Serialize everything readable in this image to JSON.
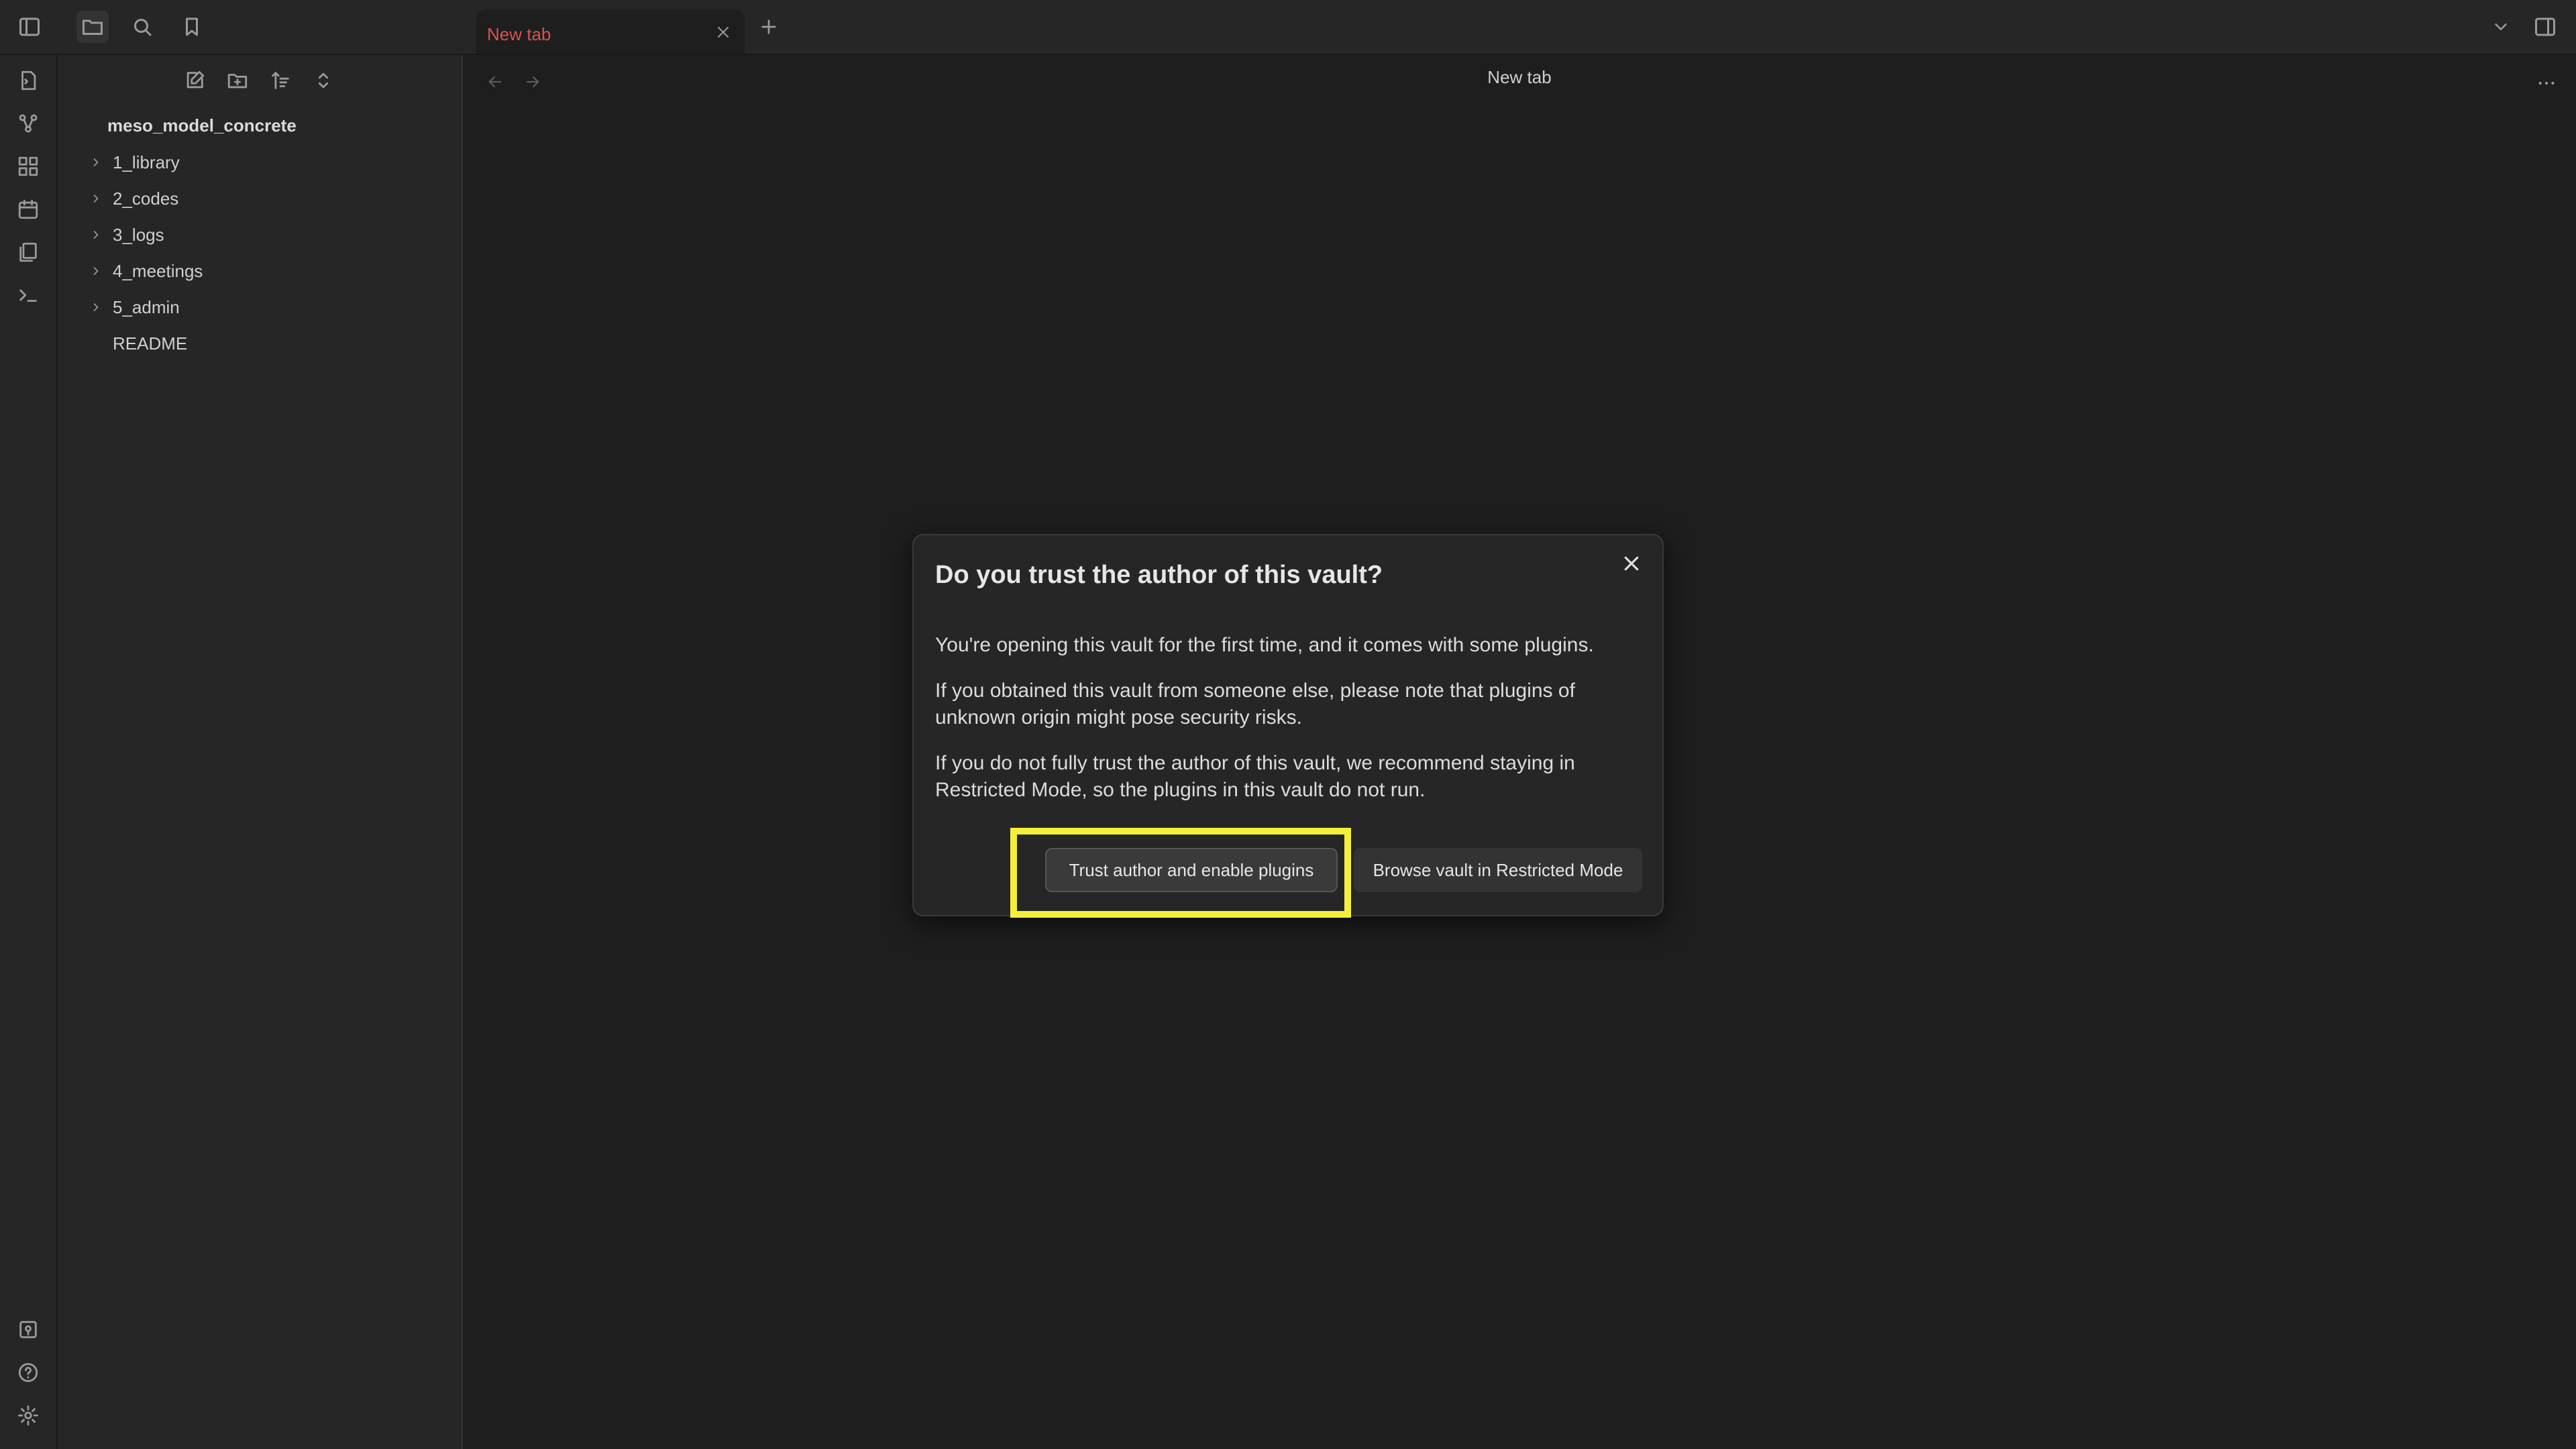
{
  "tabs": [
    {
      "label": "New tab",
      "active": true
    }
  ],
  "sidebar": {
    "vault_name": "meso_model_concrete",
    "items": [
      {
        "label": "1_library",
        "type": "folder"
      },
      {
        "label": "2_codes",
        "type": "folder"
      },
      {
        "label": "3_logs",
        "type": "folder"
      },
      {
        "label": "4_meetings",
        "type": "folder"
      },
      {
        "label": "5_admin",
        "type": "folder"
      },
      {
        "label": "README",
        "type": "file"
      }
    ]
  },
  "main": {
    "view_title": "New tab"
  },
  "modal": {
    "title": "Do you trust the author of this vault?",
    "paragraphs": [
      "You're opening this vault for the first time, and it comes with some plugins.",
      "If you obtained this vault from someone else, please note that plugins of unknown origin might pose security risks.",
      "If you do not fully trust the author of this vault, we recommend staying in Restricted Mode, so the plugins in this vault do not run."
    ],
    "trust_button": "Trust author and enable plugins",
    "browse_button": "Browse vault in Restricted Mode"
  },
  "colors": {
    "background": "#1e1e1e",
    "panel": "#262626",
    "tab_accent": "#d9534f",
    "highlight": "#f5ef3a"
  },
  "icons": {
    "titlebar": [
      "sidebar-toggle-icon",
      "folder-icon",
      "search-icon",
      "bookmark-icon",
      "chevron-down-icon",
      "right-sidebar-toggle-icon"
    ],
    "ribbon": [
      "open-quick-switcher-icon",
      "graph-icon",
      "canvas-icon",
      "daily-note-icon",
      "templates-icon",
      "command-palette-icon",
      "vault-switcher-icon",
      "help-icon",
      "settings-icon"
    ],
    "sidebar_nav": [
      "new-note-icon",
      "new-folder-icon",
      "sort-icon",
      "collapse-all-icon"
    ]
  }
}
